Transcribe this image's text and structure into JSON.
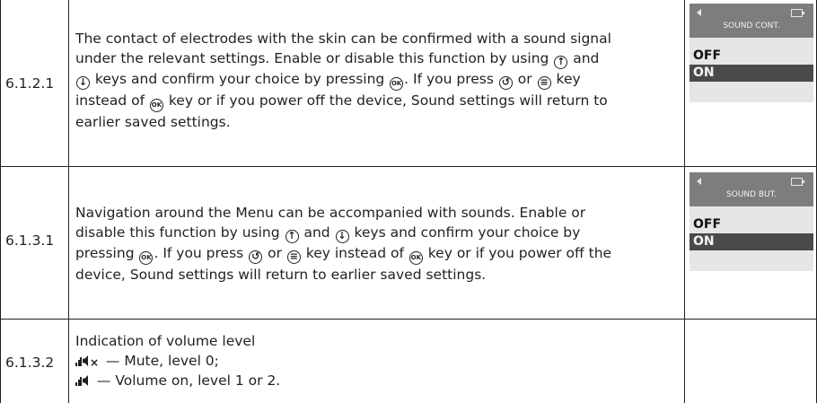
{
  "rows": [
    {
      "num": "6.1.2.1",
      "lines": [
        [
          "The contact of electrodes with the skin can be confirmed with a sound signal"
        ],
        [
          "under the relevant settings. Enable or disable this function by using ",
          "@up",
          " and"
        ],
        [
          "@down",
          " keys and confirm your choice by pressing ",
          "@ok",
          ". If you press ",
          "@back",
          " or ",
          "@menu",
          " key"
        ],
        [
          "instead of ",
          "@ok",
          " key or if you power off the device, Sound settings will return to"
        ],
        [
          "earlier saved settings."
        ]
      ],
      "screen": {
        "title": "SOUND CONT.",
        "off": "OFF",
        "on": "ON"
      }
    },
    {
      "num": "6.1.3.1",
      "lines": [
        [
          "Navigation around the Menu can be accompanied with sounds. Enable or"
        ],
        [
          "disable this function by using ",
          "@up",
          " and ",
          "@down",
          " keys and confirm your choice by"
        ],
        [
          "pressing ",
          "@ok",
          ". If you press ",
          "@back",
          " or ",
          "@menu",
          " key instead of ",
          "@ok",
          " key or if you power off the"
        ],
        [
          "device, Sound settings will return to earlier saved settings."
        ]
      ],
      "screen": {
        "title": "SOUND BUT.",
        "off": "OFF",
        "on": "ON"
      }
    },
    {
      "num": "6.1.3.2",
      "lines": [
        [
          "Indication of volume level"
        ],
        [
          "@mute",
          " — Mute, level 0;"
        ],
        [
          "@vol",
          " — Volume on, level 1 or 2."
        ]
      ]
    }
  ],
  "icons": {
    "up": "up-arrow-key-icon",
    "down": "down-arrow-key-icon",
    "ok": "ok-key-icon",
    "back": "back-key-icon",
    "menu": "menu-key-icon",
    "mute": "speaker-mute-icon",
    "vol": "speaker-volume-icon"
  }
}
